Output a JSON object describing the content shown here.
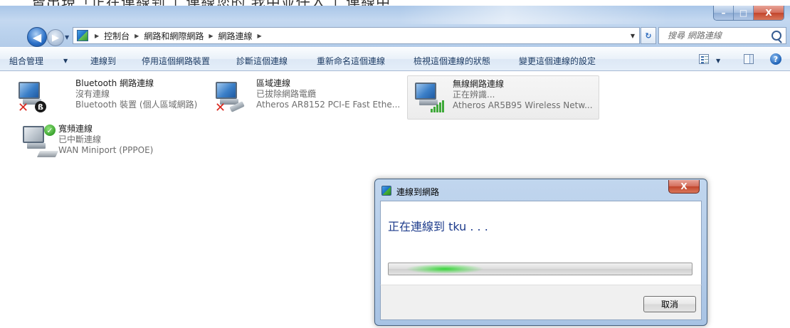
{
  "window": {
    "top_text_cropped": "皆出現「正在連線到    」連線您的    我中並任入        」連線中",
    "caption_buttons": {
      "minimize": "–",
      "maximize": "□",
      "close": "X"
    }
  },
  "address_bar": {
    "breadcrumb": [
      "控制台",
      "網路和網際網路",
      "網路連線"
    ]
  },
  "search": {
    "placeholder": "搜尋 網路連線"
  },
  "command_bar": {
    "organize": "組合管理",
    "connect_to": "連線到",
    "disable_device": "停用這個網路裝置",
    "diagnose": "診斷這個連線",
    "rename": "重新命名這個連線",
    "view_status": "檢視這個連線的狀態",
    "change_settings": "變更這個連線的設定",
    "help": "?"
  },
  "connections": [
    {
      "name": "Bluetooth 網路連線",
      "status": "沒有連線",
      "device": "Bluetooth 裝置 (個人區域網路)"
    },
    {
      "name": "區域連線",
      "status": "已拔除網路電纜",
      "device": "Atheros AR8152 PCI-E Fast Ethe..."
    },
    {
      "name": "無線網路連線",
      "status": "正在辨識...",
      "device": "Atheros AR5B95 Wireless Netw..."
    },
    {
      "name": "寬頻連線",
      "status": "已中斷連線",
      "device": "WAN Miniport (PPPOE)"
    }
  ],
  "dialog": {
    "title": "連線到網路",
    "message": "正在連線到 tku . . .",
    "cancel": "取消",
    "close": "X"
  },
  "colors": {
    "chrome": "#b3cce9",
    "dialog_message": "#1e3c8c",
    "progress_glow": "#37d43a"
  }
}
